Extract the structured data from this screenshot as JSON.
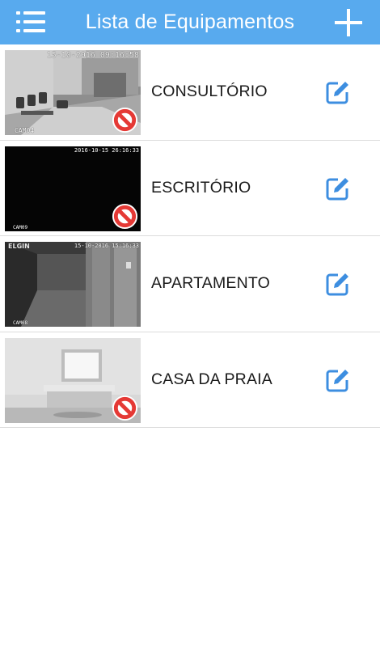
{
  "header": {
    "title": "Lista de Equipamentos",
    "menu_icon": "list-menu-icon",
    "add_icon": "plus-icon",
    "background_color": "#58aaee"
  },
  "devices": [
    {
      "name": "CONSULTÓRIO",
      "thumbnail_timestamp": "15-10-2016 09:16:58",
      "thumbnail_camera": "CAM04",
      "thumbnail_brand": "",
      "status_icon": "no-signal-icon",
      "edit_icon": "edit-icon"
    },
    {
      "name": "ESCRITÓRIO",
      "thumbnail_timestamp": "2016-10-15 26:16:33",
      "thumbnail_camera": "CAM09",
      "thumbnail_brand": "",
      "status_icon": "no-signal-icon",
      "edit_icon": "edit-icon"
    },
    {
      "name": "APARTAMENTO",
      "thumbnail_timestamp": "15-10-2016 15:16:33",
      "thumbnail_camera": "CAM08",
      "thumbnail_brand": "ELGIN",
      "status_icon": "",
      "edit_icon": "edit-icon"
    },
    {
      "name": "CASA DA PRAIA",
      "thumbnail_timestamp": "",
      "thumbnail_camera": "",
      "thumbnail_brand": "",
      "status_icon": "no-signal-icon",
      "edit_icon": "edit-icon"
    }
  ],
  "colors": {
    "accent": "#58aaee",
    "edit_icon": "#3d8ee0",
    "no_signal": "#e53935"
  }
}
